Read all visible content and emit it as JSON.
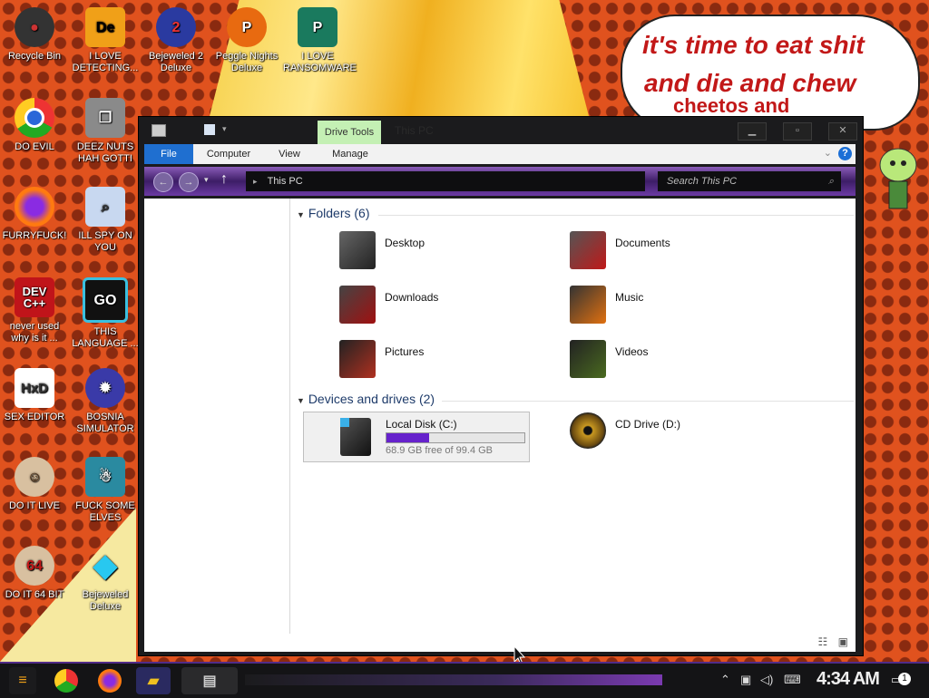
{
  "desktop": {
    "speech_bubble": {
      "line1": "it's time to eat shit",
      "line2": "and die and chew",
      "line3": "cheetos and"
    },
    "icons": [
      {
        "label": "Recycle Bin",
        "icon": "recycle-bin-icon"
      },
      {
        "label": "I LOVE DETECTING...",
        "icon": "detect-it-easy-icon"
      },
      {
        "label": "Bejeweled 2 Deluxe",
        "icon": "bejeweled-2-icon"
      },
      {
        "label": "Peggle Nights Deluxe",
        "icon": "peggle-icon"
      },
      {
        "label": "I LOVE RANSOMWARE",
        "icon": "publisher-icon"
      },
      {
        "label": "DO EVIL",
        "icon": "chrome-icon"
      },
      {
        "label": "DEEZ NUTS HAH GOTTI",
        "icon": "window-stack-icon"
      },
      {
        "label": "FURRYFUCK!",
        "icon": "firefox-icon"
      },
      {
        "label": "ILL SPY ON YOU",
        "icon": "spy-glass-icon"
      },
      {
        "label": "never used why is it ...",
        "icon": "dev-cpp-icon"
      },
      {
        "label": "THIS LANGUAGE ...",
        "icon": "goland-icon"
      },
      {
        "label": "SEX EDITOR",
        "icon": "hxd-icon"
      },
      {
        "label": "BOSNIA SIMULATOR",
        "icon": "bomb-icon"
      },
      {
        "label": "DO IT LIVE",
        "icon": "portrait-icon"
      },
      {
        "label": "FUCK SOME ELVES",
        "icon": "santa-icon"
      },
      {
        "label": "DO IT 64 BIT",
        "icon": "portrait-64-icon"
      },
      {
        "label": "Bejeweled Deluxe",
        "icon": "diamond-icon"
      }
    ]
  },
  "window": {
    "title": "This PC",
    "drive_tools": "Drive Tools",
    "controls": {
      "minimize": "▁",
      "maximize": "▫",
      "close": "✕"
    },
    "ribbon_tabs": [
      "File",
      "Computer",
      "View",
      "Manage"
    ],
    "help": "?",
    "address": "This PC",
    "search_placeholder": "Search This PC",
    "folders_header": "Folders (6)",
    "folders": [
      "Desktop",
      "Documents",
      "Downloads",
      "Music",
      "Pictures",
      "Videos"
    ],
    "devices_header": "Devices and drives (2)",
    "local_disk": {
      "name": "Local Disk (C:)",
      "free_text": "68.9 GB free of 99.4 GB",
      "used_fraction": 0.307
    },
    "cd_drive": {
      "name": "CD Drive (D:)"
    }
  },
  "taskbar": {
    "clock": "4:34 AM",
    "notification_count": "1",
    "apps": [
      "start-icon",
      "chrome-icon",
      "firefox-icon",
      "file-explorer-icon",
      "remote-desktop-icon"
    ]
  },
  "colors": {
    "accent": "#6622cc",
    "ribbon_file": "#1f6fd0",
    "drive_tools": "#c4f0b4",
    "speech_text": "#c21818"
  }
}
